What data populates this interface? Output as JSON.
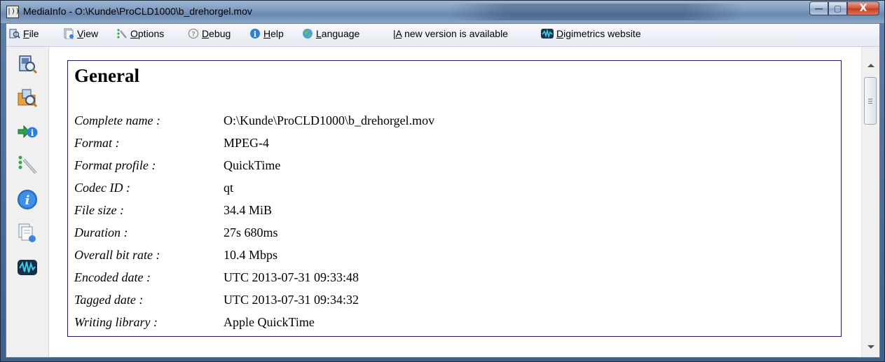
{
  "window": {
    "title": "MediaInfo - O:\\Kunde\\ProCLD1000\\b_drehorgel.mov",
    "app_icon_glyph": "|))",
    "controls": {
      "minimize": "—",
      "maximize": "▢",
      "close": "X"
    }
  },
  "menubar": {
    "file": {
      "pre": "",
      "u": "F",
      "post": "ile",
      "icon": "file-icon"
    },
    "view": {
      "pre": "",
      "u": "V",
      "post": "iew",
      "icon": "view-icon"
    },
    "options": {
      "pre": "",
      "u": "O",
      "post": "ptions",
      "icon": "options-icon"
    },
    "debug": {
      "pre": "",
      "u": "D",
      "post": "ebug",
      "icon": "debug-icon"
    },
    "help": {
      "pre": "",
      "u": "H",
      "post": "elp",
      "icon": "help-icon"
    },
    "language": {
      "pre": "",
      "u": "L",
      "post": "anguage",
      "icon": "globe-icon"
    },
    "update": {
      "pre": "|",
      "u": "A",
      "post": " new version is available"
    },
    "website": {
      "pre": "",
      "u": "D",
      "post": "igimetrics website",
      "icon": "digimetrics-icon"
    }
  },
  "toolbar_icons": [
    "open-file-icon",
    "open-folder-icon",
    "export-icon",
    "preferences-icon",
    "about-icon",
    "sheet-view-icon",
    "website-icon"
  ],
  "general": {
    "title": "General",
    "fields": [
      {
        "label": "Complete name :",
        "value": "O:\\Kunde\\ProCLD1000\\b_drehorgel.mov"
      },
      {
        "label": "Format :",
        "value": "MPEG-4"
      },
      {
        "label": "Format profile :",
        "value": "QuickTime"
      },
      {
        "label": "Codec ID :",
        "value": "qt"
      },
      {
        "label": "File size :",
        "value": "34.4 MiB"
      },
      {
        "label": "Duration :",
        "value": "27s 680ms"
      },
      {
        "label": "Overall bit rate :",
        "value": "10.4 Mbps"
      },
      {
        "label": "Encoded date :",
        "value": "UTC 2013-07-31 09:33:48"
      },
      {
        "label": "Tagged date :",
        "value": "UTC 2013-07-31 09:34:32"
      },
      {
        "label": "Writing library :",
        "value": "Apple QuickTime"
      }
    ]
  },
  "colors": {
    "box_border": "#1a1a6e",
    "titlebar": "#7f9cc0",
    "close": "#c43d20"
  }
}
